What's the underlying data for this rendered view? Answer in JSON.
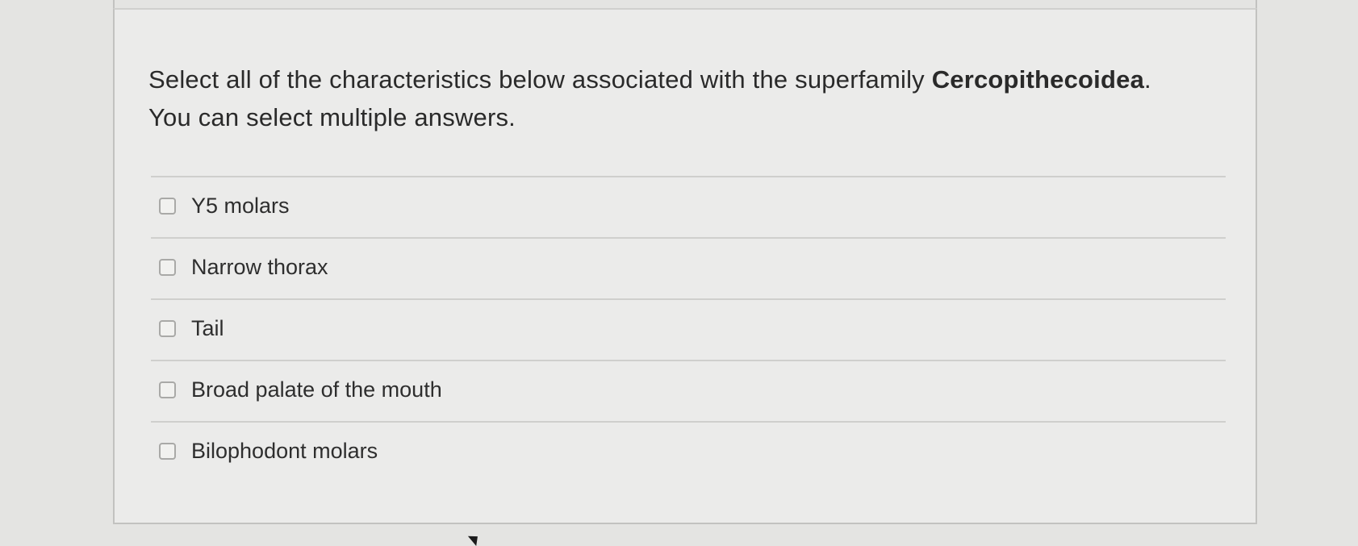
{
  "question": {
    "prompt_before": "Select all of the characteristics below associated with the superfamily ",
    "prompt_bold": "Cercopithecoidea",
    "prompt_after": ".",
    "instruction": "You can select multiple answers."
  },
  "answers": [
    {
      "label": "Y5 molars",
      "checked": false
    },
    {
      "label": "Narrow thorax",
      "checked": false
    },
    {
      "label": "Tail",
      "checked": false
    },
    {
      "label": "Broad palate of the mouth",
      "checked": false
    },
    {
      "label": "Bilophodont molars",
      "checked": false
    }
  ]
}
